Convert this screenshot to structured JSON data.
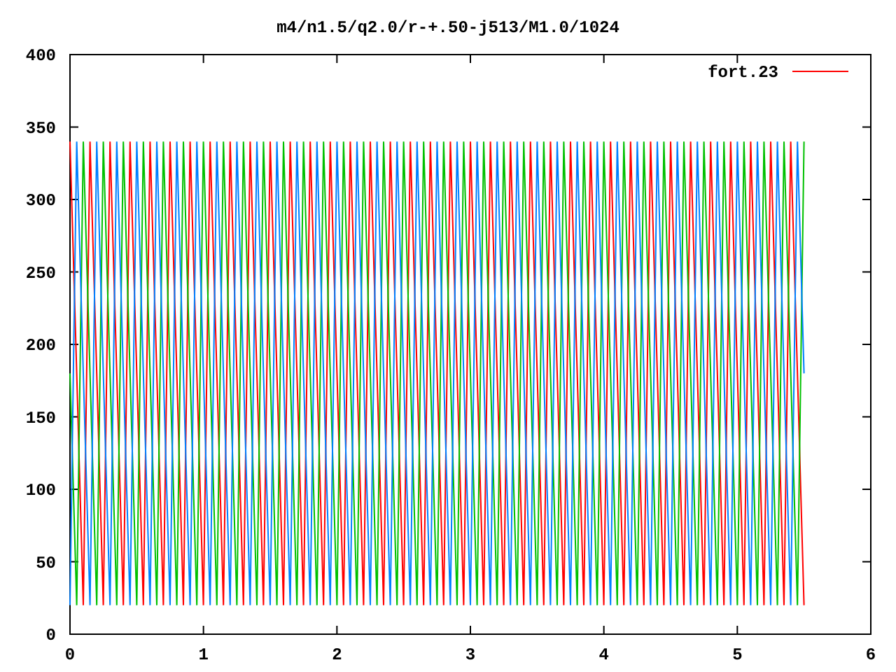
{
  "plot": {
    "chart_data": {
      "type": "line",
      "title": "m4/n1.5/q2.0/r-+.50-j513/M1.0/1024",
      "xlim": [
        0,
        6
      ],
      "ylim": [
        0,
        400
      ],
      "xticks": [
        0,
        1,
        2,
        3,
        4,
        5,
        6
      ],
      "yticks": [
        0,
        50,
        100,
        150,
        200,
        250,
        300,
        350,
        400
      ],
      "x": [
        0,
        0.05,
        0.1,
        0.15,
        0.2,
        0.25,
        0.3,
        0.35,
        0.4,
        0.45,
        0.5,
        0.55,
        0.6,
        0.65,
        0.7,
        0.75,
        0.8,
        0.85,
        0.9,
        0.95,
        1,
        1.05,
        1.1,
        1.15,
        1.2,
        1.25,
        1.3,
        1.35,
        1.4,
        1.45,
        1.5,
        1.55,
        1.6,
        1.65,
        1.7,
        1.75,
        1.8,
        1.85,
        1.9,
        1.95,
        2,
        2.05,
        2.1,
        2.15,
        2.2,
        2.25,
        2.3,
        2.35,
        2.4,
        2.45,
        2.5,
        2.55,
        2.6,
        2.65,
        2.7,
        2.75,
        2.8,
        2.85,
        2.9,
        2.95,
        3,
        3.05,
        3.1,
        3.15,
        3.2,
        3.25,
        3.3,
        3.35,
        3.4,
        3.45,
        3.5,
        3.55,
        3.6,
        3.65,
        3.7,
        3.75,
        3.8,
        3.85,
        3.9,
        3.95,
        4,
        4.05,
        4.1,
        4.15,
        4.2,
        4.25,
        4.3,
        4.35,
        4.4,
        4.45,
        4.5,
        4.55,
        4.6,
        4.65,
        4.7,
        4.75,
        4.8,
        4.85,
        4.9,
        4.95,
        5,
        5.05,
        5.1,
        5.15,
        5.2,
        5.25,
        5.3,
        5.35,
        5.4,
        5.45,
        5.5
      ],
      "series": [
        {
          "name": "fort.23",
          "color": "#ff0000",
          "values": [
            340,
            180,
            20,
            340,
            180,
            20,
            340,
            180,
            20,
            340,
            180,
            20,
            340,
            180,
            20,
            340,
            180,
            20,
            340,
            180,
            20,
            340,
            180,
            20,
            340,
            180,
            20,
            340,
            180,
            20,
            340,
            180,
            20,
            340,
            180,
            20,
            340,
            180,
            20,
            340,
            180,
            20,
            340,
            180,
            20,
            340,
            180,
            20,
            340,
            180,
            20,
            340,
            180,
            20,
            340,
            180,
            20,
            340,
            180,
            20,
            340,
            180,
            20,
            340,
            180,
            20,
            340,
            180,
            20,
            340,
            180,
            20,
            340,
            180,
            20,
            340,
            180,
            20,
            340,
            180,
            20,
            340,
            180,
            20,
            340,
            180,
            20,
            340,
            180,
            20,
            340,
            180,
            20,
            340,
            180,
            20,
            340,
            180,
            20,
            340,
            180,
            20,
            340,
            180,
            20,
            340,
            180,
            20,
            340,
            180,
            20
          ]
        },
        {
          "color": "#00c000",
          "values": [
            180,
            20,
            340,
            180,
            20,
            340,
            180,
            20,
            340,
            180,
            20,
            340,
            180,
            20,
            340,
            180,
            20,
            340,
            180,
            20,
            340,
            180,
            20,
            340,
            180,
            20,
            340,
            180,
            20,
            340,
            180,
            20,
            340,
            180,
            20,
            340,
            180,
            20,
            340,
            180,
            20,
            340,
            180,
            20,
            340,
            180,
            20,
            340,
            180,
            20,
            340,
            180,
            20,
            340,
            180,
            20,
            340,
            180,
            20,
            340,
            180,
            20,
            340,
            180,
            20,
            340,
            180,
            20,
            340,
            180,
            20,
            340,
            180,
            20,
            340,
            180,
            20,
            340,
            180,
            20,
            340,
            180,
            20,
            340,
            180,
            20,
            340,
            180,
            20,
            340,
            180,
            20,
            340,
            180,
            20,
            340,
            180,
            20,
            340,
            180,
            20,
            340,
            180,
            20,
            340,
            180,
            20,
            340,
            180,
            20,
            340
          ]
        },
        {
          "color": "#0080ff",
          "values": [
            20,
            340,
            180,
            20,
            340,
            180,
            20,
            340,
            180,
            20,
            340,
            180,
            20,
            340,
            180,
            20,
            340,
            180,
            20,
            340,
            180,
            20,
            340,
            180,
            20,
            340,
            180,
            20,
            340,
            180,
            20,
            340,
            180,
            20,
            340,
            180,
            20,
            340,
            180,
            20,
            340,
            180,
            20,
            340,
            180,
            20,
            340,
            180,
            20,
            340,
            180,
            20,
            340,
            180,
            20,
            340,
            180,
            20,
            340,
            180,
            20,
            340,
            180,
            20,
            340,
            180,
            20,
            340,
            180,
            20,
            340,
            180,
            20,
            340,
            180,
            20,
            340,
            180,
            20,
            340,
            180,
            20,
            340,
            180,
            20,
            340,
            180,
            20,
            340,
            180,
            20,
            340,
            180,
            20,
            340,
            180,
            20,
            340,
            180,
            20,
            340,
            180,
            20,
            340,
            180,
            20,
            340,
            180,
            20,
            340,
            180
          ]
        }
      ]
    }
  }
}
